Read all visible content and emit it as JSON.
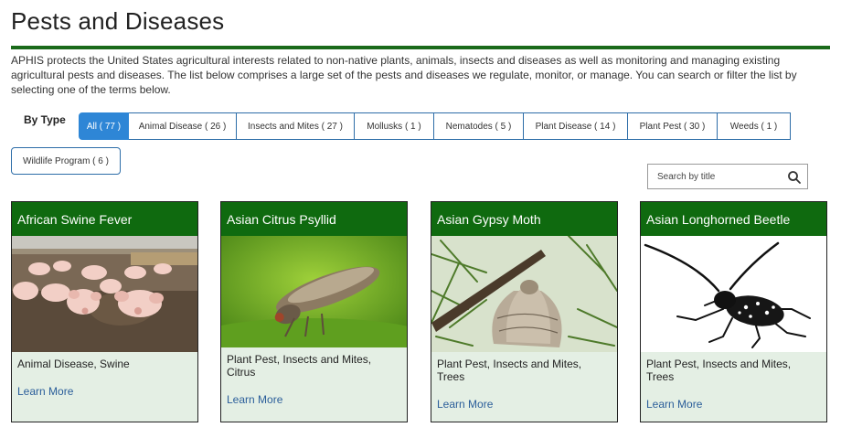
{
  "page": {
    "title": "Pests and Diseases",
    "intro": "APHIS protects the United States agricultural interests related to non-native plants, animals, insects and diseases as well as monitoring and managing existing agricultural pests and diseases. The list below comprises a large set of the pests and diseases we regulate, monitor, or manage. You can search or filter the list by selecting one of the terms below."
  },
  "filters": {
    "label": "By Type",
    "items": [
      {
        "label": "All ( 77 )",
        "active": true
      },
      {
        "label": "Animal Disease ( 26 )"
      },
      {
        "label": "Insects and Mites ( 27 )"
      },
      {
        "label": "Mollusks ( 1 )"
      },
      {
        "label": "Nematodes ( 5 )"
      },
      {
        "label": "Plant Disease ( 14 )"
      },
      {
        "label": "Plant Pest ( 30 )"
      },
      {
        "label": "Weeds ( 1 )"
      },
      {
        "label": "Wildlife Program ( 6 )"
      }
    ]
  },
  "search": {
    "placeholder": "Search by title",
    "icon": "search-icon"
  },
  "cards": [
    {
      "title": "African Swine Fever",
      "tags": "Animal Disease, Swine",
      "link": "Learn More",
      "image": "pigs-photo"
    },
    {
      "title": "Asian Citrus Psyllid",
      "tags": "Plant Pest, Insects and Mites, Citrus",
      "link": "Learn More",
      "image": "psyllid-photo"
    },
    {
      "title": "Asian Gypsy Moth",
      "tags": "Plant Pest, Insects and Mites, Trees",
      "link": "Learn More",
      "image": "moth-photo"
    },
    {
      "title": "Asian Longhorned Beetle",
      "tags": "Plant Pest, Insects and Mites, Trees",
      "link": "Learn More",
      "image": "beetle-photo"
    }
  ],
  "colors": {
    "title_rule": "#1a6a1a",
    "card_header": "#0f6a0f",
    "card_body": "#e4efe4",
    "active_filter": "#2e86d6",
    "filter_border": "#2d6da8",
    "link": "#2b5e9a"
  }
}
